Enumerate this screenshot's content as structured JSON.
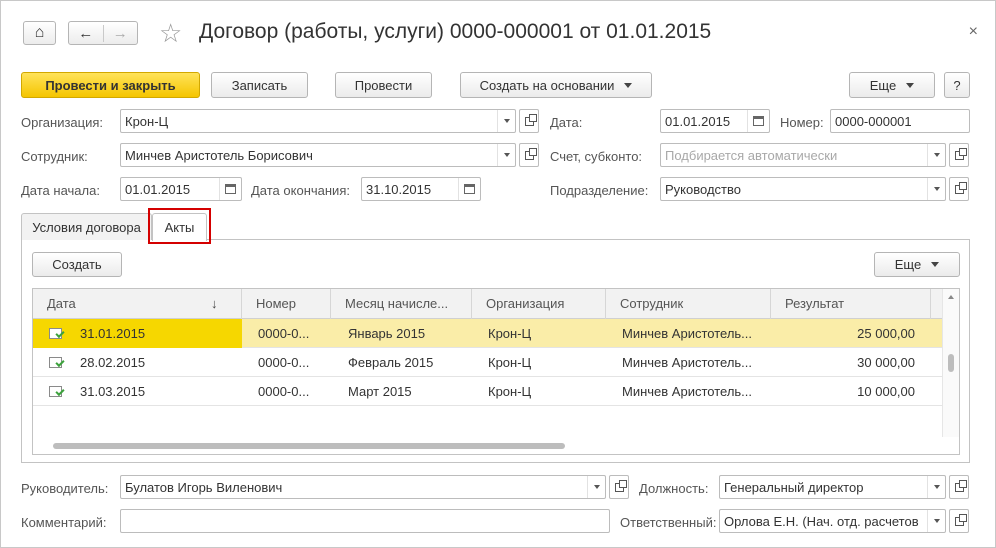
{
  "window": {
    "title": "Договор (работы, услуги) 0000-000001 от 01.01.2015",
    "close_glyph": "×",
    "home_glyph": "⌂",
    "back_glyph": "←",
    "forward_glyph": "→",
    "star_glyph": "☆"
  },
  "toolbar": {
    "post_close": "Провести и закрыть",
    "save": "Записать",
    "post": "Провести",
    "create_based": "Создать на основании",
    "more": "Еще",
    "help": "?"
  },
  "fields": {
    "org_label": "Организация:",
    "org_value": "Крон-Ц",
    "date_label": "Дата:",
    "date_value": "01.01.2015",
    "number_label": "Номер:",
    "number_value": "0000-000001",
    "employee_label": "Сотрудник:",
    "employee_value": "Минчев Аристотель Борисович",
    "account_label": "Счет, субконто:",
    "account_placeholder": "Подбирается автоматически",
    "start_label": "Дата начала:",
    "start_value": "01.01.2015",
    "end_label": "Дата окончания:",
    "end_value": "31.10.2015",
    "division_label": "Подразделение:",
    "division_value": "Руководство",
    "manager_label": "Руководитель:",
    "manager_value": "Булатов Игорь Виленович",
    "position_label": "Должность:",
    "position_value": "Генеральный директор",
    "comment_label": "Комментарий:",
    "comment_value": "",
    "responsible_label": "Ответственный:",
    "responsible_value": "Орлова Е.Н. (Нач. отд. расчетов"
  },
  "tabs": [
    {
      "label": "Условия договора"
    },
    {
      "label": "Акты"
    }
  ],
  "acts": {
    "create_button": "Создать",
    "more_button": "Еще",
    "sort_glyph": "↓",
    "columns": [
      "Дата",
      "Номер",
      "Месяц начисле...",
      "Организация",
      "Сотрудник",
      "Результат"
    ],
    "rows": [
      {
        "date": "31.01.2015",
        "number": "0000-0...",
        "month": "Январь 2015",
        "org": "Крон-Ц",
        "employee": "Минчев Аристотель...",
        "result": "25 000,00"
      },
      {
        "date": "28.02.2015",
        "number": "0000-0...",
        "month": "Февраль 2015",
        "org": "Крон-Ц",
        "employee": "Минчев Аристотель...",
        "result": "30 000,00"
      },
      {
        "date": "31.03.2015",
        "number": "0000-0...",
        "month": "Март 2015",
        "org": "Крон-Ц",
        "employee": "Минчев Аристотель...",
        "result": "10 000,00"
      }
    ]
  },
  "colors": {
    "primary_button": "#f5c500",
    "selected_row": "#faeda8",
    "highlight_frame": "#d40000"
  }
}
